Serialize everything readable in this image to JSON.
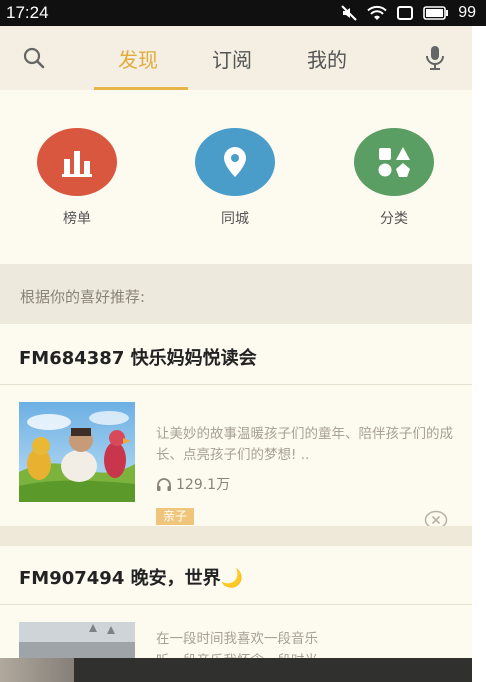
{
  "status": {
    "time": "17:24",
    "battery": "99",
    "icons": [
      "mute-icon",
      "wifi-icon",
      "screen-icon",
      "battery-icon"
    ]
  },
  "nav": {
    "tabs": [
      {
        "label": "发现",
        "active": true
      },
      {
        "label": "订阅",
        "active": false
      },
      {
        "label": "我的",
        "active": false
      }
    ],
    "accent": "#e2ac3c"
  },
  "categories": [
    {
      "label": "榜单",
      "icon": "bar-chart-icon",
      "color": "#d9573f"
    },
    {
      "label": "同城",
      "icon": "location-pin-icon",
      "color": "#4a9dc9"
    },
    {
      "label": "分类",
      "icon": "category-shapes-icon",
      "color": "#5b9e63"
    }
  ],
  "recommend": {
    "heading": "根据你的喜好推荐:"
  },
  "cards": [
    {
      "title": "FM684387  快乐妈妈悦读会",
      "description": "让美妙的故事温暖孩子们的童年、陪伴孩子们的成长、点亮孩子们的梦想! ..",
      "listens": "129.1万",
      "tag": "亲子"
    },
    {
      "title": "FM907494  晚安，世界🌙",
      "description": "在一段时间我喜欢一段音乐\n听一段音乐我怀念一段时光 .."
    }
  ]
}
